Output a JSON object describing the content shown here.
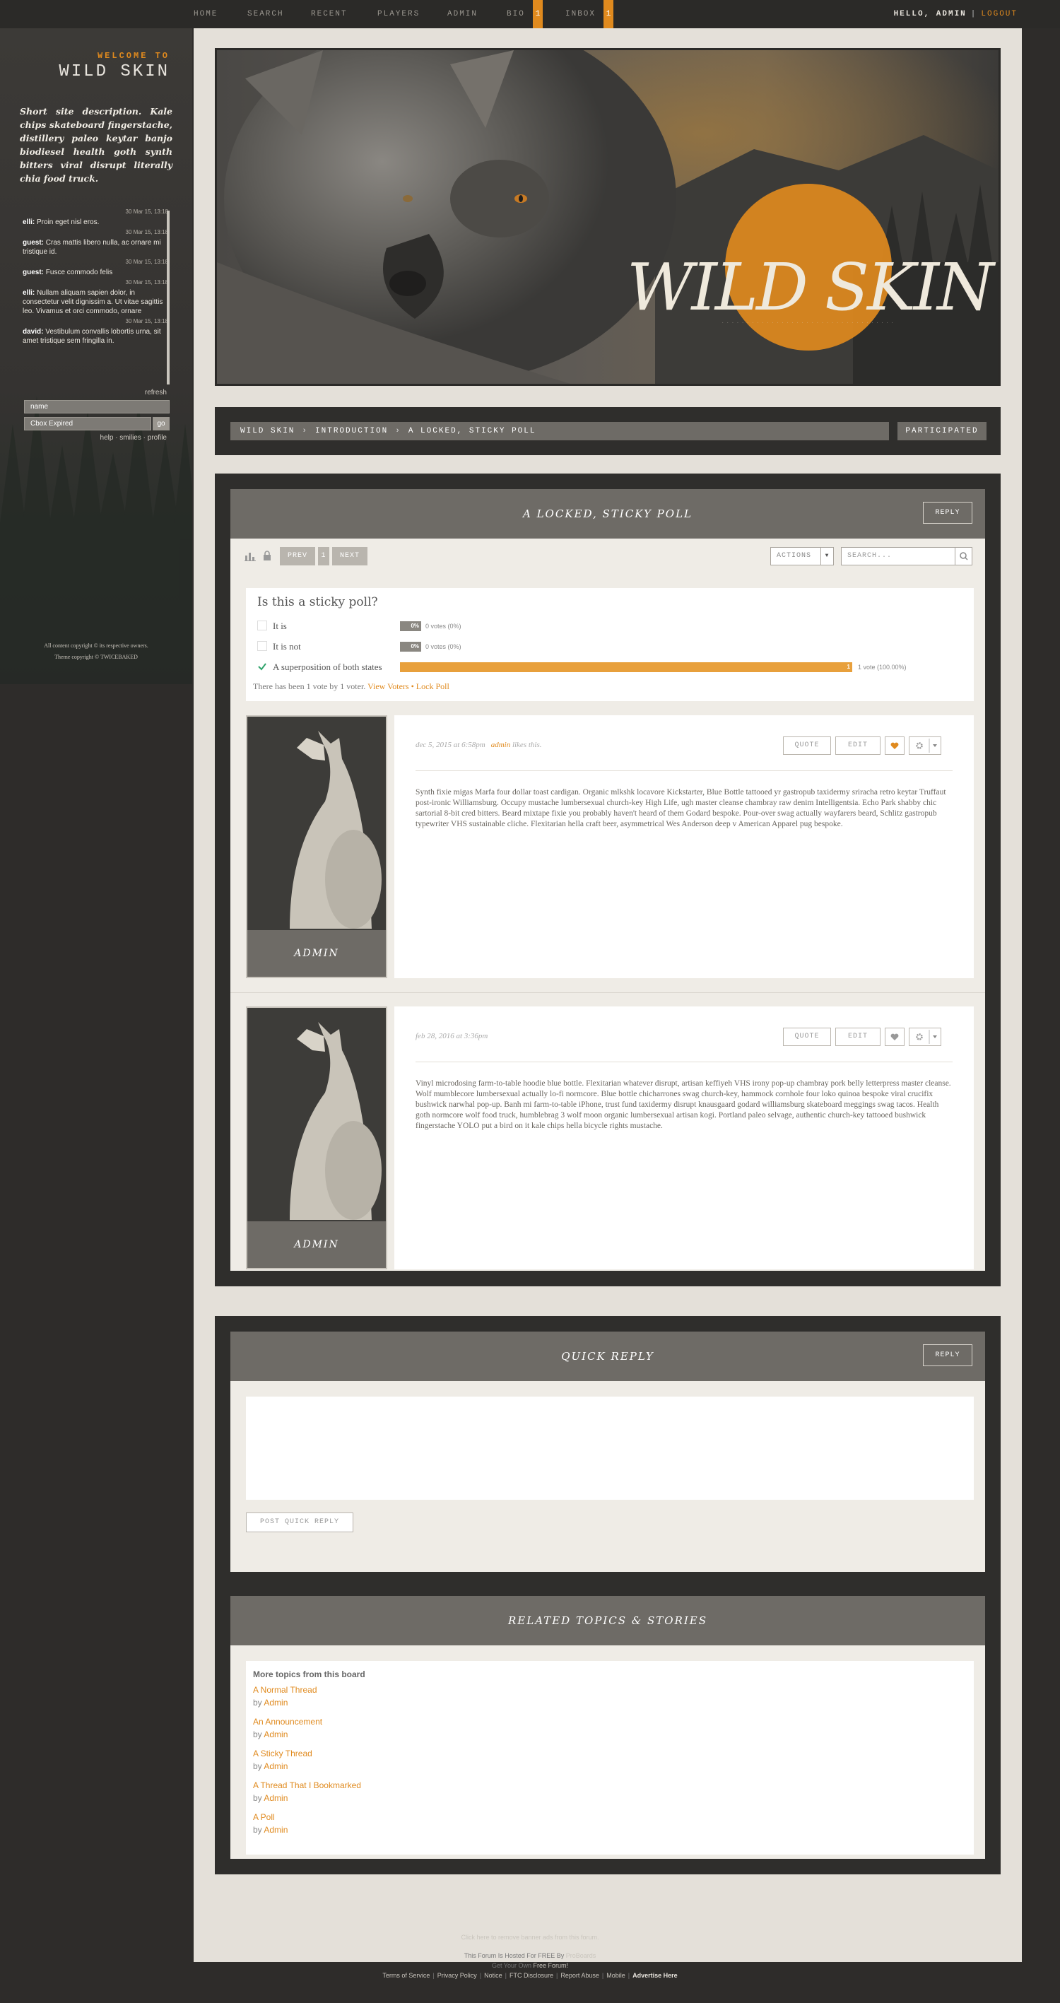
{
  "nav": {
    "items": [
      "HOME",
      "SEARCH",
      "RECENT",
      "PLAYERS",
      "ADMIN",
      "BIO",
      "INBOX"
    ],
    "bio_badge": "1",
    "inbox_badge": "1",
    "greeting": "HELLO, ADMIN",
    "separator": "|",
    "logout": "LOGOUT"
  },
  "sidebar": {
    "welcome": "WELCOME TO",
    "site_name": "WILD SKIN",
    "description": "Short site description. Kale chips skateboard fingerstache, distillery paleo keytar banjo biodiesel health goth synth bitters viral disrupt literally chia food truck.",
    "chat": [
      {
        "time": "30 Mar 15, 13:18",
        "user": "elli:",
        "text": "Proin eget nisl eros."
      },
      {
        "time": "30 Mar 15, 13:18",
        "user": "guest:",
        "text": "Cras mattis libero nulla, ac ornare mi tristique id."
      },
      {
        "time": "30 Mar 15, 13:18",
        "user": "guest:",
        "text": "Fusce commodo felis"
      },
      {
        "time": "30 Mar 15, 13:18",
        "user": "elli:",
        "text": "Nullam aliquam sapien dolor, in consectetur velit dignissim a. Ut vitae sagittis leo. Vivamus et orci commodo, ornare"
      },
      {
        "time": "30 Mar 15, 13:18",
        "user": "david:",
        "text": "Vestibulum convallis lobortis urna, sit amet tristique sem fringilla in."
      }
    ],
    "refresh": "refresh",
    "name_value": "name",
    "message_value": "Cbox Expired",
    "go": "go",
    "help": "help · smilies · profile",
    "copyright1": "All content copyright © its respective owners.",
    "copyright2": "Theme copyright © TWICEBAKED"
  },
  "banner": {
    "title": "WILD SKIN",
    "tagline": "· · · · · · · · · · · · · · · · · · · · · · · · · · · · · · · · · · ·"
  },
  "breadcrumb": {
    "items": [
      "WILD SKIN",
      "INTRODUCTION",
      "A LOCKED, STICKY POLL"
    ],
    "arrow": "›",
    "participated": "PARTICIPATED"
  },
  "thread": {
    "title": "A LOCKED, STICKY POLL",
    "reply": "REPLY",
    "prev": "PREV",
    "page": "1",
    "next": "NEXT",
    "actions": "ACTIONS",
    "search_placeholder": "SEARCH...",
    "poll": {
      "question": "Is this a sticky poll?",
      "options": [
        {
          "label": "It is",
          "votes": "0 votes (0%)",
          "percent": 0,
          "bar_label": "0%"
        },
        {
          "label": "It is not",
          "votes": "0 votes (0%)",
          "percent": 0,
          "bar_label": "0%"
        },
        {
          "label": "A superposition of both states",
          "votes": "1 vote (100.00%)",
          "percent": 100,
          "bar_label": "1"
        }
      ],
      "footer_text": "There has been 1 vote by 1 voter.",
      "view_voters": "View Voters",
      "dot": "•",
      "lock_poll": "Lock Poll"
    },
    "posts": [
      {
        "author": "ADMIN",
        "date": "dec 5, 2015 at 6:58pm",
        "likes_user": "admin",
        "likes_text": "likes this.",
        "quote": "QUOTE",
        "edit": "EDIT",
        "body": "Synth fixie migas Marfa four dollar toast cardigan. Organic mlkshk locavore Kickstarter, Blue Bottle tattooed yr gastropub taxidermy sriracha retro keytar Truffaut post-ironic Williamsburg. Occupy mustache lumbersexual church-key High Life, ugh master cleanse chambray raw denim Intelligentsia. Echo Park shabby chic sartorial 8-bit cred bitters. Beard mixtape fixie you probably haven't heard of them Godard bespoke. Pour-over swag actually wayfarers beard, Schlitz gastropub typewriter VHS sustainable cliche. Flexitarian hella craft beer, asymmetrical Wes Anderson deep v American Apparel pug bespoke."
      },
      {
        "author": "ADMIN",
        "date": "feb 28, 2016 at 3:36pm",
        "likes_user": "",
        "likes_text": "",
        "quote": "QUOTE",
        "edit": "EDIT",
        "body": "Vinyl microdosing farm-to-table hoodie blue bottle. Flexitarian whatever disrupt, artisan keffiyeh VHS irony pop-up chambray pork belly letterpress master cleanse. Wolf mumblecore lumbersexual actually lo-fi normcore. Blue bottle chicharrones swag church-key, hammock cornhole four loko quinoa bespoke viral crucifix bushwick narwhal pop-up. Banh mi farm-to-table iPhone, trust fund taxidermy disrupt knausgaard godard williamsburg skateboard meggings swag tacos. Health goth normcore wolf food truck, humblebrag 3 wolf moon organic lumbersexual artisan kogi. Portland paleo selvage, authentic church-key tattooed bushwick fingerstache YOLO put a bird on it kale chips hella bicycle rights mustache."
      }
    ]
  },
  "quick_reply": {
    "title": "QUICK REPLY",
    "reply": "REPLY",
    "post_button": "POST QUICK REPLY"
  },
  "related": {
    "title": "RELATED TOPICS & STORIES",
    "heading": "More topics from this board",
    "by": "by",
    "topics": [
      {
        "title": "A Normal Thread",
        "author": "Admin"
      },
      {
        "title": "An Announcement",
        "author": "Admin"
      },
      {
        "title": "A Sticky Thread",
        "author": "Admin"
      },
      {
        "title": "A Thread That I Bookmarked",
        "author": "Admin"
      },
      {
        "title": "A Poll",
        "author": "Admin"
      }
    ]
  },
  "footer": {
    "remove_ads": "Click here to remove banner ads from this forum.",
    "hosted": "This Forum Is Hosted For FREE By",
    "hosted_brand": "ProBoards",
    "get_own": "Get Your Own",
    "free_forum": "Free Forum!",
    "links": [
      "Terms of Service",
      "Privacy Policy",
      "Notice",
      "FTC Disclosure",
      "Report Abuse",
      "Mobile",
      "Advertise Here"
    ]
  },
  "colors": {
    "accent": "#e08a1e",
    "panel_dark": "#2f2e2c",
    "header_gray": "#6e6b66",
    "page_bg": "#2e2c2a"
  }
}
